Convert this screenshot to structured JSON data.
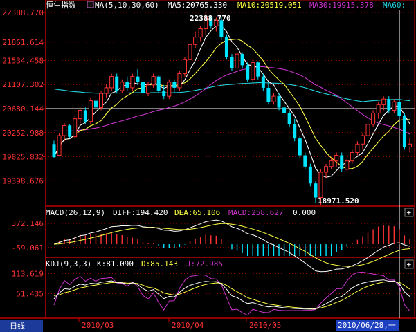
{
  "colors": {
    "background": "#000000",
    "axis_red": "#c00000",
    "up": "#ff3333",
    "down": "#00e5ff",
    "ma5": "#ffffff",
    "ma10": "#ffff44",
    "ma30": "#cc33cc",
    "ma60": "#22d3dd",
    "label_white": "#ffffff",
    "label_red": "#ff3333",
    "tab_bg": "#1b3a9a",
    "date_hl_bg": "#1d40c0"
  },
  "header": {
    "title": "恒生指数",
    "ma_params": "MA(5,10,30,60)",
    "ma5": "MA5:20765.330",
    "ma10": "MA10:20519.051",
    "ma30": "MA30:19915.378",
    "ma60": "MA60:"
  },
  "macd_header": {
    "params": "MACD(26,12,9)",
    "diff": "DIFF:194.420",
    "dea": "DEA:65.106",
    "macd": "MACD:258.627",
    "extra": "0.000"
  },
  "kdj_header": {
    "params": "KDJ(9,3,3)",
    "k": "K:81.090",
    "d": "D:85.143",
    "j": "J:72.985"
  },
  "annotations": {
    "high": "22388.770",
    "low": "18971.520"
  },
  "bottom_bar": {
    "tab": "日线",
    "dates": [
      "2010/03",
      "2010/04",
      "2010/05",
      "2010/06"
    ],
    "selected_date": "2010/06/28,一"
  },
  "plus_icons": [
    "+",
    "+"
  ],
  "chart_data": [
    {
      "type": "candlestick",
      "y_ticks": [
        "22388.770",
        "21861.614",
        "21534.458",
        "21107.302",
        "20680.144",
        "20252.988",
        "19825.832",
        "19398.676"
      ],
      "y_tick_values": [
        22388.77,
        21861.614,
        21534.458,
        21107.302,
        20680.144,
        20252.988,
        19825.832,
        19398.676
      ],
      "ylim": [
        18971.52,
        22388.77
      ],
      "crosshair_value": 20680.144,
      "x_labels": [
        "2010/03",
        "2010/04",
        "2010/05",
        "2010/06"
      ],
      "candles": [
        [
          20050,
          20110,
          19800,
          19820
        ],
        [
          19850,
          20250,
          19830,
          20200
        ],
        [
          20200,
          20420,
          20100,
          20380
        ],
        [
          20380,
          20400,
          20150,
          20180
        ],
        [
          20180,
          20560,
          20150,
          20500
        ],
        [
          20500,
          20700,
          20420,
          20650
        ],
        [
          20650,
          20700,
          20400,
          20450
        ],
        [
          20450,
          20880,
          20400,
          20820
        ],
        [
          20820,
          20950,
          20650,
          20700
        ],
        [
          20700,
          21000,
          20650,
          20950
        ],
        [
          20950,
          21120,
          20880,
          21050
        ],
        [
          21050,
          21300,
          21000,
          21250
        ],
        [
          21250,
          21300,
          20950,
          21000
        ],
        [
          21000,
          21200,
          20950,
          21150
        ],
        [
          21150,
          21250,
          21000,
          21050
        ],
        [
          21050,
          21300,
          21000,
          21250
        ],
        [
          21250,
          21380,
          21100,
          21150
        ],
        [
          21150,
          21200,
          20900,
          20950
        ],
        [
          20950,
          21150,
          20900,
          21100
        ],
        [
          21100,
          21300,
          21050,
          21250
        ],
        [
          21250,
          21280,
          20950,
          21000
        ],
        [
          21000,
          21100,
          20850,
          20900
        ],
        [
          20900,
          21200,
          20850,
          21150
        ],
        [
          21150,
          21200,
          20950,
          21050
        ],
        [
          21050,
          21350,
          21000,
          21300
        ],
        [
          21300,
          21600,
          21250,
          21550
        ],
        [
          21550,
          21880,
          21500,
          21820
        ],
        [
          21820,
          22050,
          21750,
          21950
        ],
        [
          21950,
          22150,
          21880,
          22100
        ],
        [
          22100,
          22389,
          22000,
          22300
        ],
        [
          22300,
          22350,
          22100,
          22150
        ],
        [
          22150,
          22300,
          22050,
          22250
        ],
        [
          22250,
          22300,
          21900,
          21950
        ],
        [
          21950,
          22000,
          21550,
          21600
        ],
        [
          21600,
          21650,
          21350,
          21400
        ],
        [
          21400,
          21700,
          21350,
          21650
        ],
        [
          21650,
          21680,
          21400,
          21450
        ],
        [
          21450,
          21500,
          21150,
          21200
        ],
        [
          21200,
          21550,
          21150,
          21500
        ],
        [
          21500,
          21520,
          21200,
          21250
        ],
        [
          21250,
          21300,
          21000,
          21050
        ],
        [
          21050,
          21150,
          20750,
          20800
        ],
        [
          20800,
          20950,
          20750,
          20900
        ],
        [
          20900,
          20950,
          20650,
          20700
        ],
        [
          20700,
          20850,
          20550,
          20600
        ],
        [
          20600,
          20650,
          20350,
          20400
        ],
        [
          20400,
          20500,
          20100,
          20150
        ],
        [
          20150,
          20200,
          19800,
          19850
        ],
        [
          19850,
          19900,
          19600,
          19650
        ],
        [
          19650,
          19700,
          19300,
          19350
        ],
        [
          19350,
          19400,
          19000,
          19100
        ],
        [
          19100,
          19600,
          18971.52,
          19550
        ],
        [
          19550,
          19700,
          19450,
          19650
        ],
        [
          19650,
          19800,
          19600,
          19750
        ],
        [
          19750,
          19900,
          19650,
          19850
        ],
        [
          19850,
          19900,
          19550,
          19600
        ],
        [
          19600,
          19800,
          19550,
          19750
        ],
        [
          19750,
          19950,
          19700,
          19900
        ],
        [
          19900,
          20100,
          19850,
          20050
        ],
        [
          20050,
          20250,
          19950,
          20200
        ],
        [
          20200,
          20450,
          20150,
          20400
        ],
        [
          20400,
          20650,
          20350,
          20600
        ],
        [
          20600,
          20800,
          20500,
          20750
        ],
        [
          20750,
          20900,
          20650,
          20850
        ],
        [
          20850,
          20900,
          20600,
          20650
        ],
        [
          20650,
          20850,
          20600,
          20800
        ],
        [
          20800,
          20850,
          20500,
          20550
        ],
        [
          20550,
          20600,
          19950,
          20000
        ],
        [
          20000,
          20150,
          19900,
          20050
        ]
      ]
    },
    {
      "type": "bar",
      "name": "MACD",
      "y_ticks": [
        "372.146",
        "-59.061"
      ],
      "y_tick_values": [
        372.146,
        -59.061
      ],
      "ylim": [
        -210,
        460
      ]
    },
    {
      "type": "line",
      "name": "KDJ",
      "y_ticks": [
        "113.619",
        "51.435"
      ],
      "y_tick_values": [
        113.619,
        51.435
      ],
      "ylim": [
        -20,
        125
      ]
    }
  ]
}
